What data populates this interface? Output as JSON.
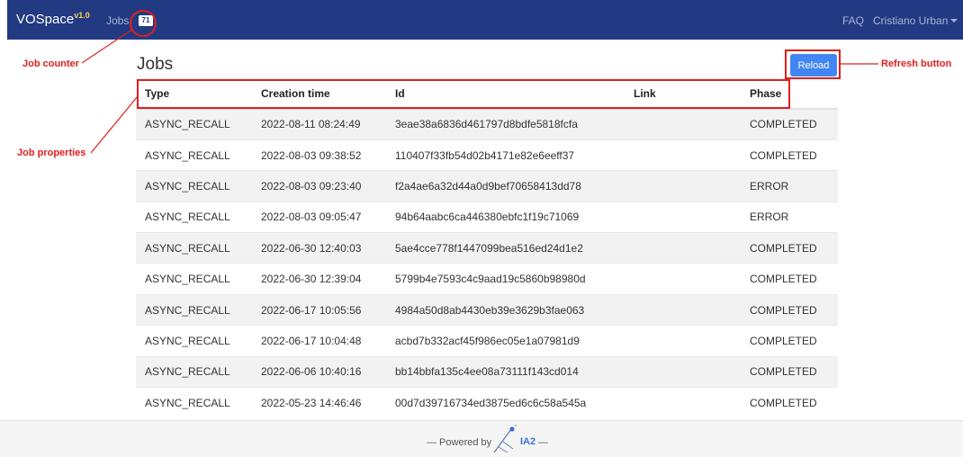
{
  "navbar": {
    "brand": "VOSpace",
    "version": "v1.0",
    "jobs_label": "Jobs",
    "jobs_count": "71",
    "faq_label": "FAQ",
    "user_label": "Cristiano Urban"
  },
  "page_title": "Jobs",
  "reload_label": "Reload",
  "table": {
    "headers": [
      "Type",
      "Creation time",
      "Id",
      "Link",
      "Phase"
    ],
    "rows": [
      {
        "type": "ASYNC_RECALL",
        "creation_time": "2022-08-11 08:24:49",
        "id": "3eae38a6836d461797d8bdfe5818fcfa",
        "link": "",
        "phase": "COMPLETED"
      },
      {
        "type": "ASYNC_RECALL",
        "creation_time": "2022-08-03 09:38:52",
        "id": "110407f33fb54d02b4171e82e6eeff37",
        "link": "",
        "phase": "COMPLETED"
      },
      {
        "type": "ASYNC_RECALL",
        "creation_time": "2022-08-03 09:23:40",
        "id": "f2a4ae6a32d44a0d9bef70658413dd78",
        "link": "",
        "phase": "ERROR"
      },
      {
        "type": "ASYNC_RECALL",
        "creation_time": "2022-08-03 09:05:47",
        "id": "94b64aabc6ca446380ebfc1f19c71069",
        "link": "",
        "phase": "ERROR"
      },
      {
        "type": "ASYNC_RECALL",
        "creation_time": "2022-06-30 12:40:03",
        "id": "5ae4cce778f1447099bea516ed24d1e2",
        "link": "",
        "phase": "COMPLETED"
      },
      {
        "type": "ASYNC_RECALL",
        "creation_time": "2022-06-30 12:39:04",
        "id": "5799b4e7593c4c9aad19c5860b98980d",
        "link": "",
        "phase": "COMPLETED"
      },
      {
        "type": "ASYNC_RECALL",
        "creation_time": "2022-06-17 10:05:56",
        "id": "4984a50d8ab4430eb39e3629b3fae063",
        "link": "",
        "phase": "COMPLETED"
      },
      {
        "type": "ASYNC_RECALL",
        "creation_time": "2022-06-17 10:04:48",
        "id": "acbd7b332acf45f986ec05e1a07981d9",
        "link": "",
        "phase": "COMPLETED"
      },
      {
        "type": "ASYNC_RECALL",
        "creation_time": "2022-06-06 10:40:16",
        "id": "bb14bbfa135c4ee08a73111f143cd014",
        "link": "",
        "phase": "COMPLETED"
      },
      {
        "type": "ASYNC_RECALL",
        "creation_time": "2022-05-23 14:46:46",
        "id": "00d7d39716734ed3875ed6c6c58a545a",
        "link": "",
        "phase": "COMPLETED"
      }
    ]
  },
  "footer": {
    "powered_by": "— Powered by",
    "logo_label": "IA2",
    "trailing_dash": "—"
  },
  "annotations": {
    "job_counter": "Job counter",
    "job_properties": "Job properties",
    "refresh_button": "Refresh button"
  },
  "colors": {
    "navbar_bg": "#223a82",
    "reload_button_bg": "#4285f4",
    "annotation_red": "#e01e1e",
    "version_yellow": "#ffd54a"
  }
}
